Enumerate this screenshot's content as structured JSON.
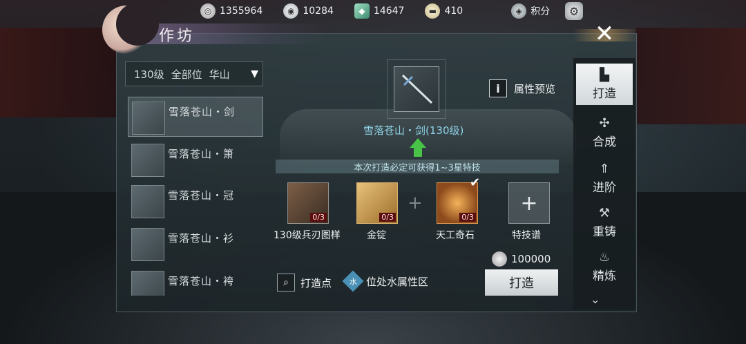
{
  "currencies": [
    {
      "icon": "coin-icon",
      "value": "1355964"
    },
    {
      "icon": "silver-icon",
      "value": "10284"
    },
    {
      "icon": "jade-icon",
      "value": "14647"
    },
    {
      "icon": "ingot-icon",
      "value": "410"
    },
    {
      "icon": "score-icon",
      "value": "积分"
    }
  ],
  "header": {
    "title": "作坊",
    "close": "✕"
  },
  "filter": {
    "level": "130级",
    "part": "全部位",
    "school": "华山"
  },
  "items": [
    {
      "name": "雪落苍山・剑"
    },
    {
      "name": "雪落苍山・箫"
    },
    {
      "name": "雪落苍山・冠"
    },
    {
      "name": "雪落苍山・衫"
    },
    {
      "name": "雪落苍山・袴"
    }
  ],
  "forge": {
    "preview_label": "属性预览",
    "weapon_name": "雪落苍山・剑(130级)",
    "notice": "本次打造必定可获得1~3星特技",
    "materials": [
      {
        "label": "130级兵刃图样",
        "count": "0/3"
      },
      {
        "label": "金锭",
        "count": "0/3"
      },
      {
        "label": "天工奇石",
        "count": "0/3"
      },
      {
        "label": "特技谱"
      }
    ],
    "cost": "100000",
    "forge_button": "打造",
    "forge_point": "打造点",
    "water_area": "位处水属性区",
    "water_glyph": "水"
  },
  "tabs": [
    {
      "label": "打造",
      "icon": "anvil-icon"
    },
    {
      "label": "合成",
      "icon": "combine-icon"
    },
    {
      "label": "进阶",
      "icon": "advance-icon"
    },
    {
      "label": "重铸",
      "icon": "hammer-icon"
    },
    {
      "label": "精炼",
      "icon": "flame-icon"
    }
  ]
}
